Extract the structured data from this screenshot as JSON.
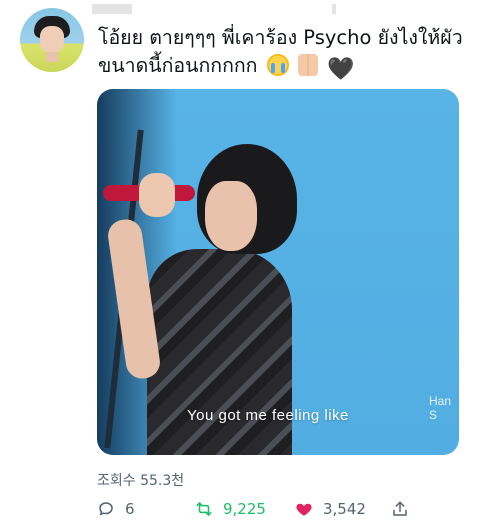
{
  "tweet": {
    "text": "โอ้ยย ตายๆๆๆ พี่เคาร้อง Psycho ยังไงให้ผัวขนาดนี้ก่อนกกกกก",
    "emojis": [
      "crying-face",
      "folded-hands",
      "black-heart"
    ]
  },
  "media": {
    "caption": "You got me feeling like",
    "watermark": "Han S"
  },
  "stats": {
    "views_label": "조회수 55.3천",
    "replies": "6",
    "retweets": "9,225",
    "likes": "3,542"
  },
  "colors": {
    "retweet": "#17bf63",
    "like": "#e0245e",
    "secondary": "#536471",
    "media_bg": "#58b3e6"
  }
}
